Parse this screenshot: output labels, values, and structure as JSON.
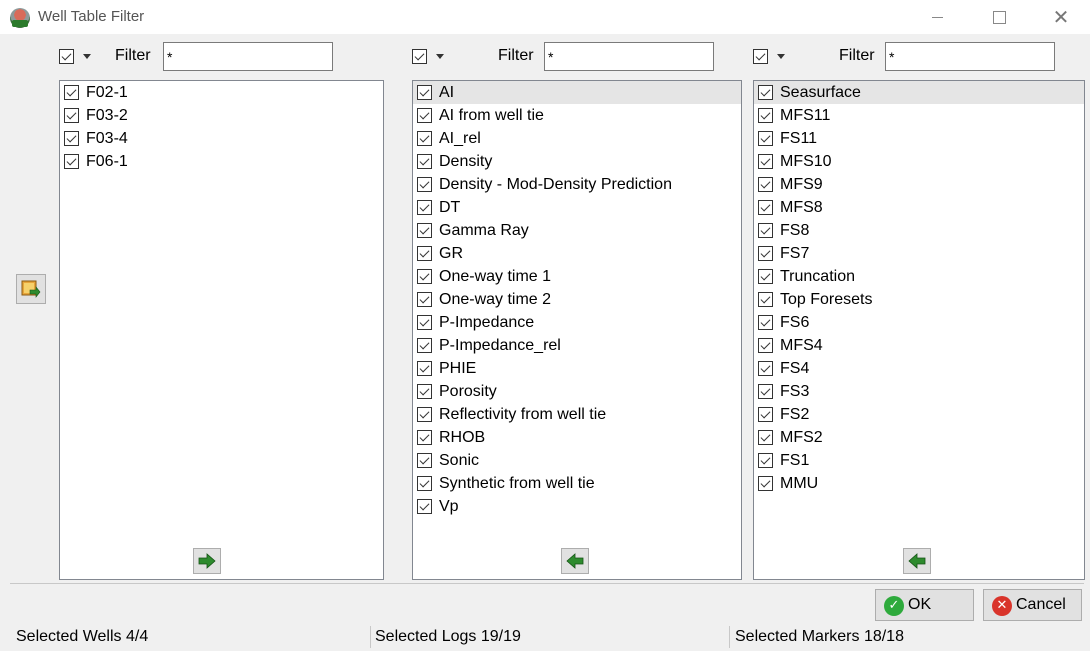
{
  "window": {
    "title": "Well Table Filter"
  },
  "wells": {
    "filter_label": "Filter",
    "filter_value": "*",
    "items": [
      {
        "label": "F02-1",
        "checked": true
      },
      {
        "label": "F03-2",
        "checked": true
      },
      {
        "label": "F03-4",
        "checked": true
      },
      {
        "label": "F06-1",
        "checked": true
      }
    ]
  },
  "logs": {
    "filter_label": "Filter",
    "filter_value": "*",
    "items": [
      {
        "label": "AI",
        "checked": true,
        "selected": true
      },
      {
        "label": "AI from well tie",
        "checked": true
      },
      {
        "label": "AI_rel",
        "checked": true
      },
      {
        "label": "Density",
        "checked": true
      },
      {
        "label": "Density - Mod-Density Prediction",
        "checked": true
      },
      {
        "label": "DT",
        "checked": true
      },
      {
        "label": "Gamma Ray",
        "checked": true
      },
      {
        "label": "GR",
        "checked": true
      },
      {
        "label": "One-way time 1",
        "checked": true
      },
      {
        "label": "One-way time 2",
        "checked": true
      },
      {
        "label": "P-Impedance",
        "checked": true
      },
      {
        "label": "P-Impedance_rel",
        "checked": true
      },
      {
        "label": "PHIE",
        "checked": true
      },
      {
        "label": "Porosity",
        "checked": true
      },
      {
        "label": "Reflectivity from well tie",
        "checked": true
      },
      {
        "label": "RHOB",
        "checked": true
      },
      {
        "label": "Sonic",
        "checked": true
      },
      {
        "label": "Synthetic from well tie",
        "checked": true
      },
      {
        "label": "Vp",
        "checked": true
      }
    ]
  },
  "markers": {
    "filter_label": "Filter",
    "filter_value": "*",
    "items": [
      {
        "label": "Seasurface",
        "checked": true,
        "selected": true
      },
      {
        "label": "MFS11",
        "checked": true
      },
      {
        "label": "FS11",
        "checked": true
      },
      {
        "label": "MFS10",
        "checked": true
      },
      {
        "label": "MFS9",
        "checked": true
      },
      {
        "label": "MFS8",
        "checked": true
      },
      {
        "label": "FS8",
        "checked": true
      },
      {
        "label": "FS7",
        "checked": true
      },
      {
        "label": "Truncation",
        "checked": true
      },
      {
        "label": "Top Foresets",
        "checked": true
      },
      {
        "label": "FS6",
        "checked": true
      },
      {
        "label": "MFS4",
        "checked": true
      },
      {
        "label": "FS4",
        "checked": true
      },
      {
        "label": "FS3",
        "checked": true
      },
      {
        "label": "FS2",
        "checked": true
      },
      {
        "label": "MFS2",
        "checked": true
      },
      {
        "label": "FS1",
        "checked": true
      },
      {
        "label": "MMU",
        "checked": true
      }
    ]
  },
  "buttons": {
    "ok": "OK",
    "cancel": "Cancel"
  },
  "status": {
    "wells": "Selected Wells 4/4",
    "logs": "Selected Logs 19/19",
    "markers": "Selected Markers 18/18"
  },
  "colors": {
    "arrow_green": "#2e8b2e",
    "ok_green": "#2eaa3c",
    "cancel_red": "#d9342b",
    "selection_gray": "#e5e5e5"
  }
}
